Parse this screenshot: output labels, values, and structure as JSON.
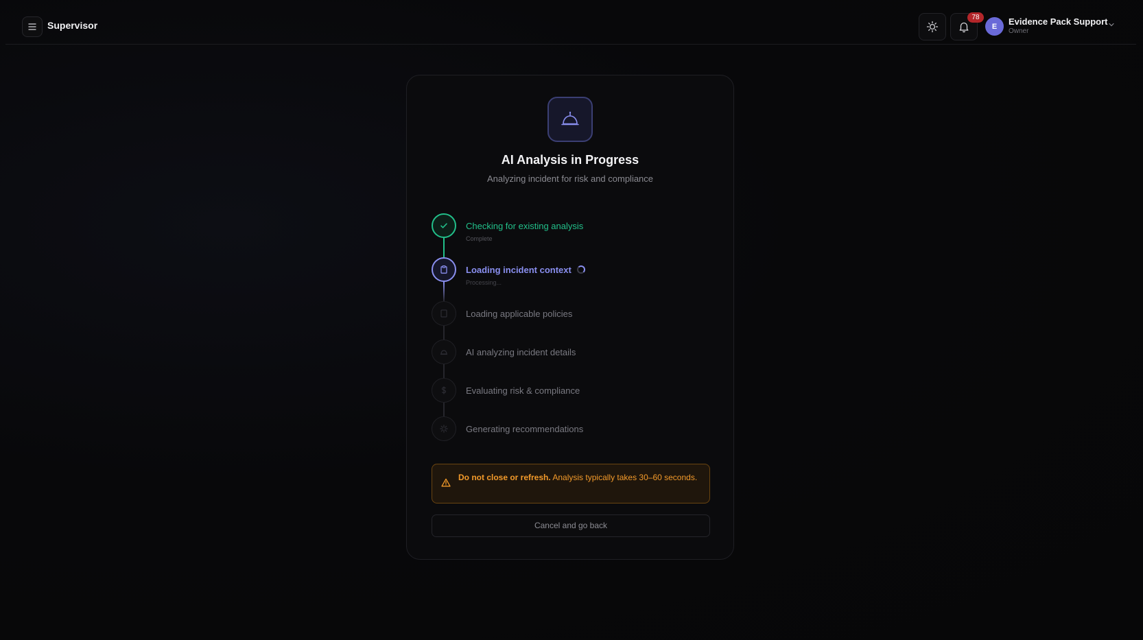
{
  "header": {
    "app_title": "Supervisor",
    "notification_count": "78",
    "user": {
      "initial": "E",
      "name": "Evidence Pack Support",
      "role": "Owner"
    }
  },
  "card": {
    "title": "AI Analysis in Progress",
    "subtitle": "Analyzing incident for risk and compliance",
    "steps": [
      {
        "label": "Checking for existing analysis",
        "status": "Complete",
        "state": "complete",
        "icon": "check-icon"
      },
      {
        "label": "Loading incident context",
        "status": "Processing...",
        "state": "active",
        "icon": "clipboard-icon"
      },
      {
        "label": "Loading applicable policies",
        "status": "",
        "state": "pending",
        "icon": "document-icon"
      },
      {
        "label": "AI analyzing incident details",
        "status": "",
        "state": "pending",
        "icon": "ai-bot-icon"
      },
      {
        "label": "Evaluating risk & compliance",
        "status": "",
        "state": "pending",
        "icon": "dollar-icon"
      },
      {
        "label": "Generating recommendations",
        "status": "",
        "state": "pending",
        "icon": "sparkle-icon"
      }
    ],
    "warning": {
      "strong": "Do not close or refresh.",
      "text": "Analysis typically takes 30–60 seconds."
    },
    "cancel_label": "Cancel and go back"
  },
  "colors": {
    "complete": "#22c08a",
    "active": "#8a8ff0",
    "pending": "#2a2a30",
    "warning": "#f39a2a",
    "badge": "#b3262a"
  }
}
